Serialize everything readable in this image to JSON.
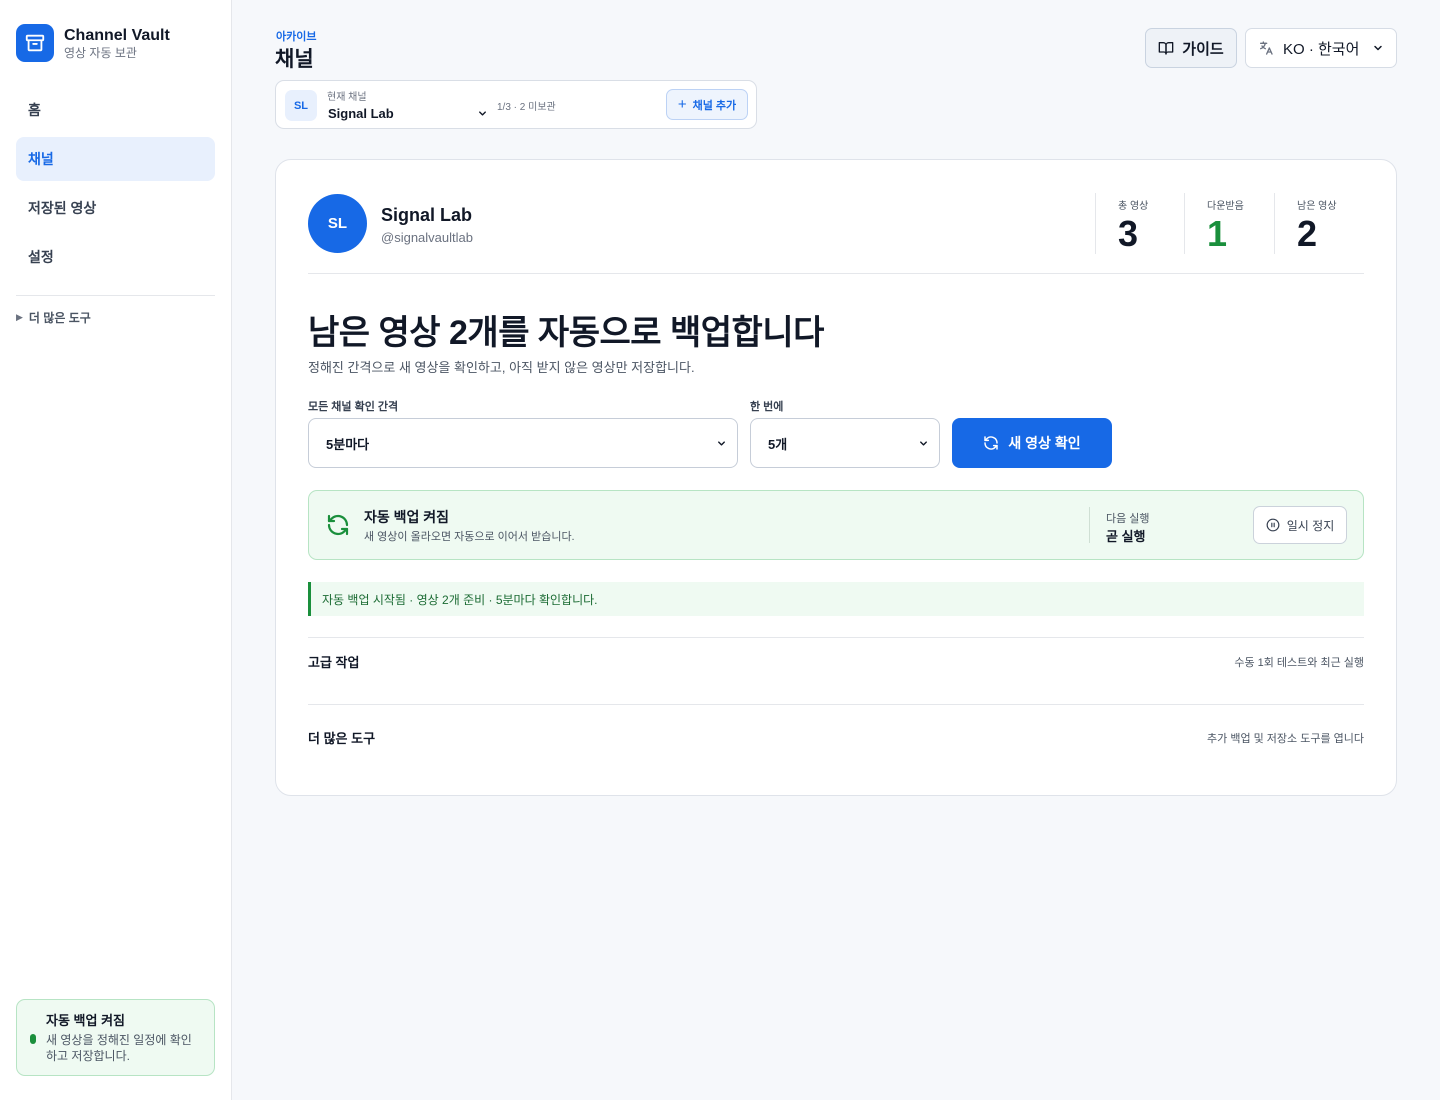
{
  "brand": {
    "name": "Channel Vault",
    "subtitle": "영상 자동 보관",
    "logo_icon": "archive-icon",
    "accent": "#1769e6"
  },
  "sidebar": {
    "items": [
      {
        "label": "홈",
        "active": false
      },
      {
        "label": "채널",
        "active": true
      },
      {
        "label": "저장된 영상",
        "active": false
      },
      {
        "label": "설정",
        "active": false
      }
    ],
    "more_tools": "더 많은 도구",
    "status": {
      "title": "자동 백업 켜짐",
      "desc": "새 영상을 정해진 일정에 확인하고 저장합니다.",
      "color": "#1a8f3c"
    }
  },
  "header": {
    "breadcrumb": "아카이브",
    "title": "채널",
    "guide_label": "가이드",
    "language_label": "KO · 한국어"
  },
  "switcher": {
    "avatar": "SL",
    "label": "현재 채널",
    "current": "Signal Lab",
    "meta": "1/3 · 2 미보관",
    "add_label": "채널 추가"
  },
  "channel": {
    "avatar": "SL",
    "name": "Signal Lab",
    "handle": "@signalvaultlab",
    "stats": [
      {
        "label": "총 영상",
        "value": "3"
      },
      {
        "label": "다운받음",
        "value": "1"
      },
      {
        "label": "남은 영상",
        "value": "2"
      }
    ]
  },
  "main": {
    "headline": "남은 영상 2개를 자동으로 백업합니다",
    "subline": "정해진 간격으로 새 영상을 확인하고, 아직 받지 않은 영상만 저장합니다.",
    "interval_label": "모든 채널 확인 간격",
    "interval_value": "5분마다",
    "batch_label": "한 번에",
    "batch_value": "5개",
    "check_button": "새 영상 확인"
  },
  "auto_panel": {
    "title": "자동 백업 켜짐",
    "desc": "새 영상이 올라오면 자동으로 이어서 받습니다.",
    "next_label": "다음 실행",
    "next_value": "곧 실행",
    "pause_label": "일시 정지"
  },
  "alert": {
    "text": "자동 백업 시작됨 · 영상 2개 준비 · 5분마다 확인합니다."
  },
  "sections": [
    {
      "title": "고급 작업",
      "note": "수동 1회 테스트와 최근 실행"
    },
    {
      "title": "더 많은 도구",
      "note": "추가 백업 및 저장소 도구를 엽니다"
    }
  ]
}
